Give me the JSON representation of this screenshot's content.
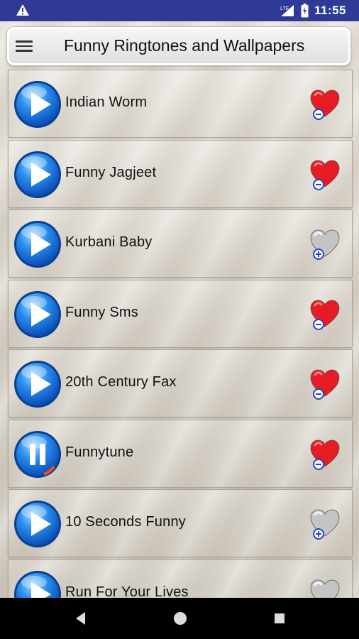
{
  "status_bar": {
    "time": "11:55",
    "network": "LTE",
    "icons": [
      "warning-icon",
      "signal-icon",
      "battery-icon"
    ]
  },
  "app_bar": {
    "title": "Funny Ringtones and Wallpapers",
    "menu_icon": "hamburger-menu-icon"
  },
  "items": [
    {
      "title": "Indian Worm",
      "state": "play",
      "favorite": true
    },
    {
      "title": "Funny Jagjeet",
      "state": "play",
      "favorite": true
    },
    {
      "title": "Kurbani Baby",
      "state": "play",
      "favorite": false
    },
    {
      "title": "Funny Sms",
      "state": "play",
      "favorite": true
    },
    {
      "title": "20th Century Fax",
      "state": "play",
      "favorite": true
    },
    {
      "title": "Funnytune",
      "state": "pause",
      "favorite": true
    },
    {
      "title": "10 Seconds Funny",
      "state": "play",
      "favorite": false
    },
    {
      "title": "Run For Your Lives",
      "state": "play",
      "favorite": false
    }
  ],
  "colors": {
    "status_bar": "#2e3a96",
    "play_blue": "#1e7be0",
    "heart_red": "#e51c23",
    "heart_gray": "#bdbdbd"
  },
  "nav_bar": {
    "icons": [
      "back-icon",
      "home-icon",
      "recents-icon"
    ]
  }
}
